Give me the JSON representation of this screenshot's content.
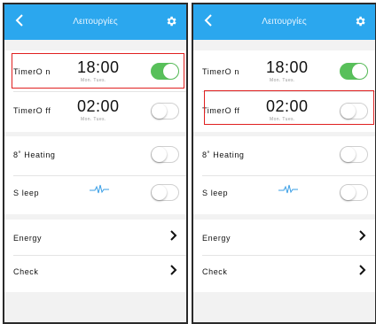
{
  "screens": [
    {
      "header": {
        "title": "Λειτουργίες",
        "back_icon": "chevron-left-icon",
        "settings_icon": "gear-icon"
      },
      "timer_on": {
        "label": "TimerO n",
        "time": "18:00",
        "days": "Mon. Tues.",
        "enabled": true
      },
      "timer_off": {
        "label": "TimerO ff",
        "time": "02:00",
        "days": "Mon. Tues.",
        "enabled": false
      },
      "heating": {
        "label": "8˚ Heating",
        "enabled": false
      },
      "sleep": {
        "label": "S leep",
        "icon": "sleep-wave-icon",
        "enabled": false
      },
      "energy": {
        "label": "Energy"
      },
      "check": {
        "label": "Check"
      },
      "highlighted": "timer_on"
    },
    {
      "header": {
        "title": "Λειτουργίες",
        "back_icon": "chevron-left-icon",
        "settings_icon": "gear-icon"
      },
      "timer_on": {
        "label": "TimerO n",
        "time": "18:00",
        "days": "Mon. Tues.",
        "enabled": true
      },
      "timer_off": {
        "label": "TimerO ff",
        "time": "02:00",
        "days": "Mon. Tues.",
        "enabled": false
      },
      "heating": {
        "label": "8˚ Heating",
        "enabled": false
      },
      "sleep": {
        "label": "S leep",
        "icon": "sleep-wave-icon",
        "enabled": false
      },
      "energy": {
        "label": "Energy"
      },
      "check": {
        "label": "Check"
      },
      "highlighted": "timer_off"
    }
  ],
  "colors": {
    "header": "#2ba7ee",
    "toggle_on": "#58c05a",
    "highlight": "#e02020"
  }
}
